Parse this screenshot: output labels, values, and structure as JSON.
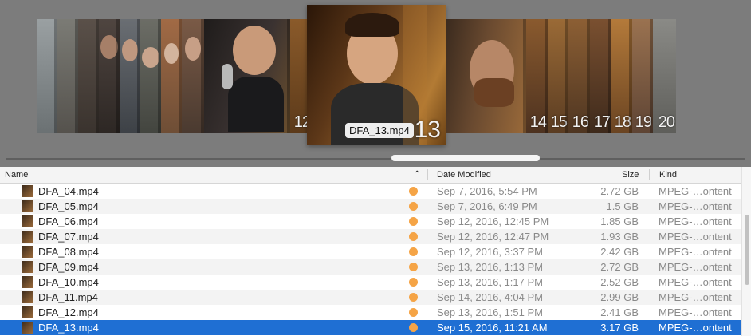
{
  "coverflow": {
    "selected_label": "DFA_13.mp4",
    "selected_number": "13",
    "left_number": "12",
    "right_numbers": [
      "14",
      "15",
      "16",
      "17",
      "18",
      "19",
      "20"
    ]
  },
  "columns": {
    "name": "Name",
    "date_modified": "Date Modified",
    "size": "Size",
    "kind": "Kind"
  },
  "icons": {
    "sort": "chevron-up-icon",
    "tag": "orange-tag-icon"
  },
  "colors": {
    "selection": "#1f6fd3",
    "tag_orange": "#f5a446"
  },
  "files": [
    {
      "name": "DFA_04.mp4",
      "date": "Sep 7, 2016, 5:54 PM",
      "size": "2.72 GB",
      "kind": "MPEG-…ontent"
    },
    {
      "name": "DFA_05.mp4",
      "date": "Sep 7, 2016, 6:49 PM",
      "size": "1.5 GB",
      "kind": "MPEG-…ontent"
    },
    {
      "name": "DFA_06.mp4",
      "date": "Sep 12, 2016, 12:45 PM",
      "size": "1.85 GB",
      "kind": "MPEG-…ontent"
    },
    {
      "name": "DFA_07.mp4",
      "date": "Sep 12, 2016, 12:47 PM",
      "size": "1.93 GB",
      "kind": "MPEG-…ontent"
    },
    {
      "name": "DFA_08.mp4",
      "date": "Sep 12, 2016, 3:37 PM",
      "size": "2.42 GB",
      "kind": "MPEG-…ontent"
    },
    {
      "name": "DFA_09.mp4",
      "date": "Sep 13, 2016, 1:13 PM",
      "size": "2.72 GB",
      "kind": "MPEG-…ontent"
    },
    {
      "name": "DFA_10.mp4",
      "date": "Sep 13, 2016, 1:17 PM",
      "size": "2.52 GB",
      "kind": "MPEG-…ontent"
    },
    {
      "name": "DFA_11.mp4",
      "date": "Sep 14, 2016, 4:04 PM",
      "size": "2.99 GB",
      "kind": "MPEG-…ontent"
    },
    {
      "name": "DFA_12.mp4",
      "date": "Sep 13, 2016, 1:51 PM",
      "size": "2.41 GB",
      "kind": "MPEG-…ontent"
    },
    {
      "name": "DFA_13.mp4",
      "date": "Sep 15, 2016, 11:21 AM",
      "size": "3.17 GB",
      "kind": "MPEG-…ontent",
      "selected": true
    }
  ]
}
